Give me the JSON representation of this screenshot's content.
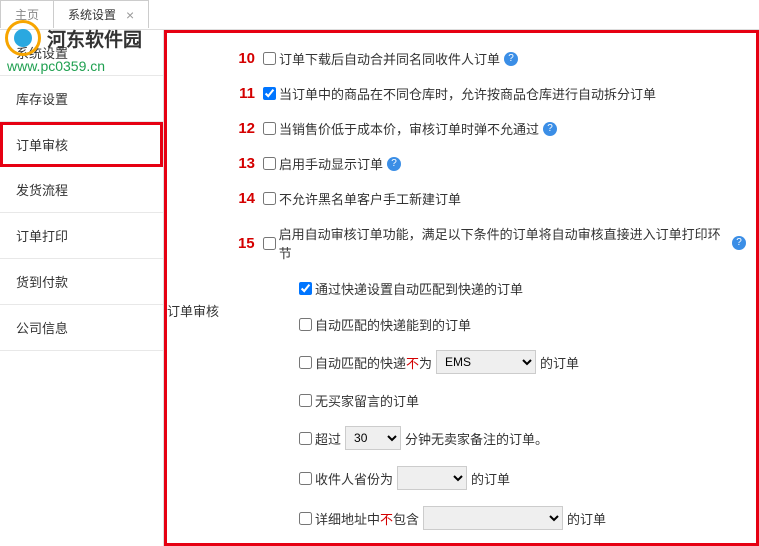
{
  "tabs": {
    "main": "主页",
    "settings": "系统设置"
  },
  "watermark": {
    "brand": "河东软件园",
    "url": "www.pc0359.cn"
  },
  "sidebar": {
    "items": [
      "系统设置",
      "库存设置",
      "订单审核",
      "发货流程",
      "订单打印",
      "货到付款",
      "公司信息"
    ]
  },
  "section_title": "订单审核",
  "options": [
    {
      "num": "10",
      "text": "订单下载后自动合并同名同收件人订单",
      "help": true,
      "checked": false
    },
    {
      "num": "11",
      "text": "当订单中的商品在不同仓库时，允许按商品仓库进行自动拆分订单",
      "help": false,
      "checked": true
    },
    {
      "num": "12",
      "text": "当销售价低于成本价，审核订单时弹不允通过",
      "help": true,
      "checked": false
    },
    {
      "num": "13",
      "text": "启用手动显示订单",
      "help": true,
      "checked": false
    },
    {
      "num": "14",
      "text": "不允许黑名单客户手工新建订单",
      "help": false,
      "checked": false
    },
    {
      "num": "15",
      "text": "启用自动审核订单功能，满足以下条件的订单将自动审核直接进入订单打印环节",
      "help": true,
      "checked": false
    }
  ],
  "sub_options": {
    "s1": {
      "text": "通过快递设置自动匹配到快递的订单",
      "checked": true
    },
    "s2": {
      "text": "自动匹配的快递能到的订单",
      "checked": false
    },
    "s3": {
      "prefix": "自动匹配的快递",
      "not": "不",
      "mid": "为",
      "select_val": "EMS",
      "suffix": "的订单",
      "checked": false
    },
    "s4": {
      "text": "无买家留言的订单",
      "checked": false
    },
    "s5": {
      "prefix": "超过",
      "select_val": "30",
      "suffix": "分钟无卖家备注的订单。",
      "checked": false
    },
    "s6": {
      "prefix": "收件人省份为",
      "select_val": "",
      "suffix": "的订单",
      "checked": false
    },
    "s7": {
      "prefix": "详细地址中",
      "not": "不",
      "mid": "包含",
      "select_val": "",
      "suffix": "的订单",
      "checked": false
    }
  }
}
